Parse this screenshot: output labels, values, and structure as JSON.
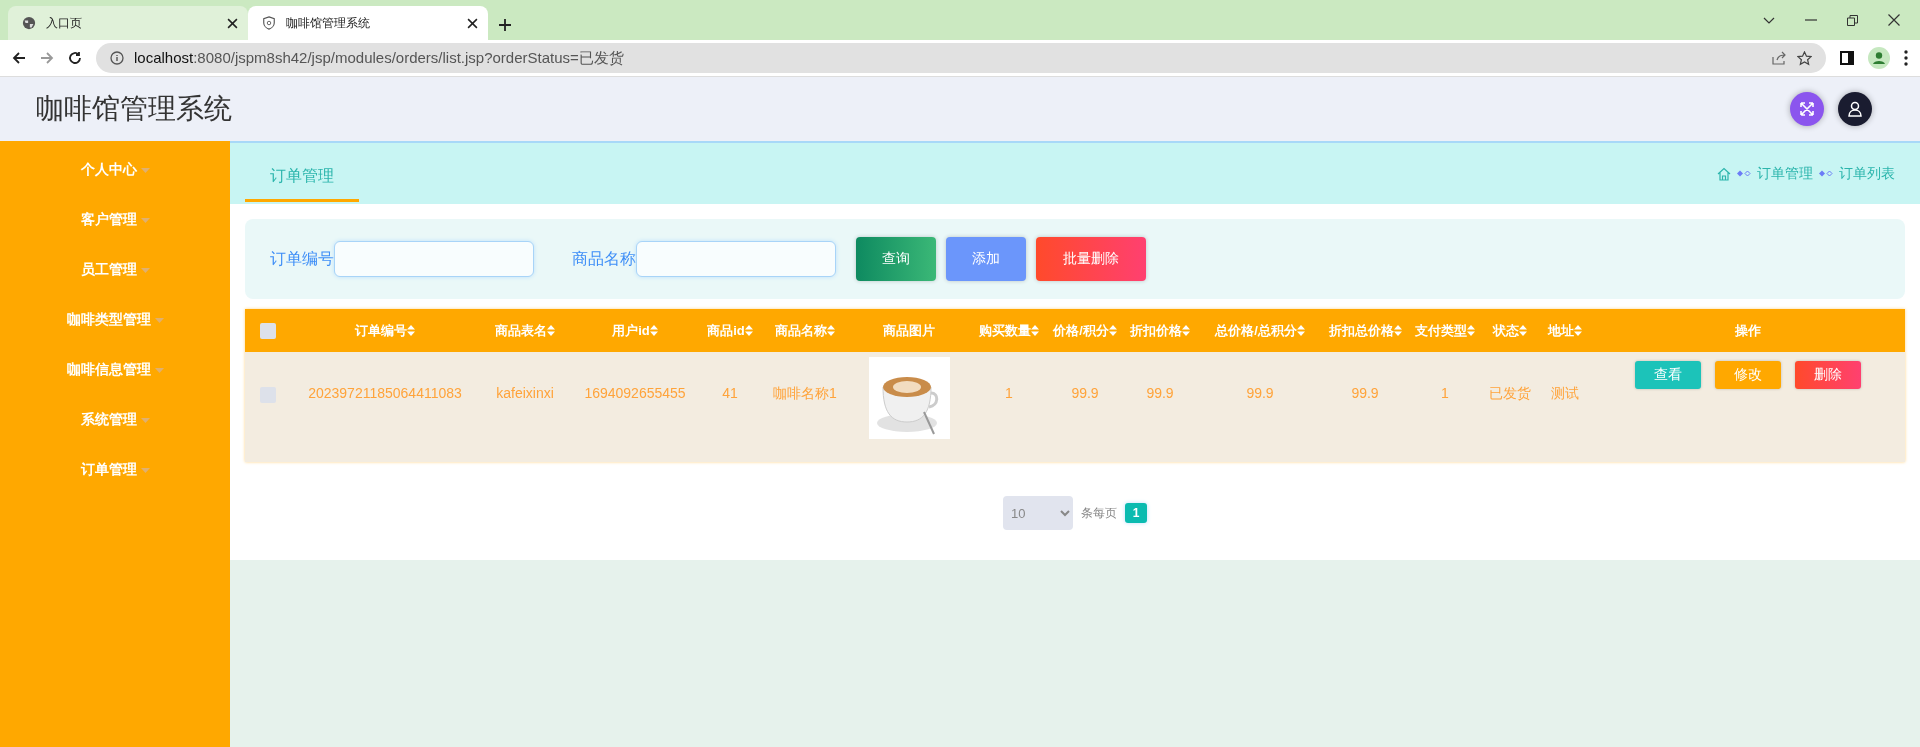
{
  "browser": {
    "tabs": [
      {
        "title": "入口页",
        "kind": "globe",
        "selected": false
      },
      {
        "title": "咖啡馆管理系统",
        "kind": "shield",
        "selected": true
      }
    ],
    "url_host": "localhost",
    "url_rest": ":8080/jspm8sh42/jsp/modules/orders/list.jsp?orderStatus=已发货",
    "forward_disabled": true
  },
  "app_title": "咖啡馆管理系统",
  "sidebar": {
    "items": [
      {
        "label": "个人中心"
      },
      {
        "label": "客户管理"
      },
      {
        "label": "员工管理"
      },
      {
        "label": "咖啡类型管理"
      },
      {
        "label": "咖啡信息管理"
      },
      {
        "label": "系统管理"
      },
      {
        "label": "订单管理"
      }
    ]
  },
  "page_tab": "订单管理",
  "breadcrumb": [
    "订单管理",
    "订单列表"
  ],
  "search": {
    "fields": [
      {
        "label": "订单编号"
      },
      {
        "label": "商品名称"
      }
    ],
    "buttons": [
      {
        "label": "查询",
        "kind": "query"
      },
      {
        "label": "添加",
        "kind": "add"
      },
      {
        "label": "批量删除",
        "kind": "delete"
      }
    ]
  },
  "table": {
    "select_all": {
      "checked": false
    },
    "columns": [
      {
        "label": "订单编号",
        "sortable": true
      },
      {
        "label": "商品表名",
        "sortable": true
      },
      {
        "label": "用户id",
        "sortable": true
      },
      {
        "label": "商品id",
        "sortable": true
      },
      {
        "label": "商品名称",
        "sortable": true
      },
      {
        "label": "商品图片",
        "sortable": false
      },
      {
        "label": "购买数量",
        "sortable": true
      },
      {
        "label": "价格/积分",
        "sortable": true
      },
      {
        "label": "折扣价格",
        "sortable": true
      },
      {
        "label": "总价格/总积分",
        "sortable": true
      },
      {
        "label": "折扣总价格",
        "sortable": true
      },
      {
        "label": "支付类型",
        "sortable": true
      },
      {
        "label": "状态",
        "sortable": true
      },
      {
        "label": "地址",
        "sortable": true
      },
      {
        "label": "操作",
        "sortable": false
      }
    ],
    "rows": [
      {
        "checked": false,
        "cells": [
          {
            "kind": "text",
            "text": "20239721185064411083"
          },
          {
            "kind": "text",
            "text": "kafeixinxi"
          },
          {
            "kind": "text",
            "text": "1694092655455"
          },
          {
            "kind": "text",
            "text": "41"
          },
          {
            "kind": "text",
            "text": "咖啡名称1"
          },
          {
            "kind": "image"
          },
          {
            "kind": "text",
            "text": "1"
          },
          {
            "kind": "text",
            "text": "99.9"
          },
          {
            "kind": "text",
            "text": "99.9"
          },
          {
            "kind": "text",
            "text": "99.9"
          },
          {
            "kind": "text",
            "text": "99.9"
          },
          {
            "kind": "text",
            "text": "1"
          },
          {
            "kind": "text",
            "text": "已发货"
          },
          {
            "kind": "text",
            "text": "测试"
          }
        ],
        "actions": [
          {
            "label": "查看",
            "kind": "view"
          },
          {
            "label": "修改",
            "kind": "edit"
          },
          {
            "label": "删除",
            "kind": "delete"
          }
        ]
      }
    ]
  },
  "pagination": {
    "page_size": "10",
    "per_page_label": "条每页",
    "pages": [
      {
        "label": "1",
        "selected": true
      }
    ]
  }
}
